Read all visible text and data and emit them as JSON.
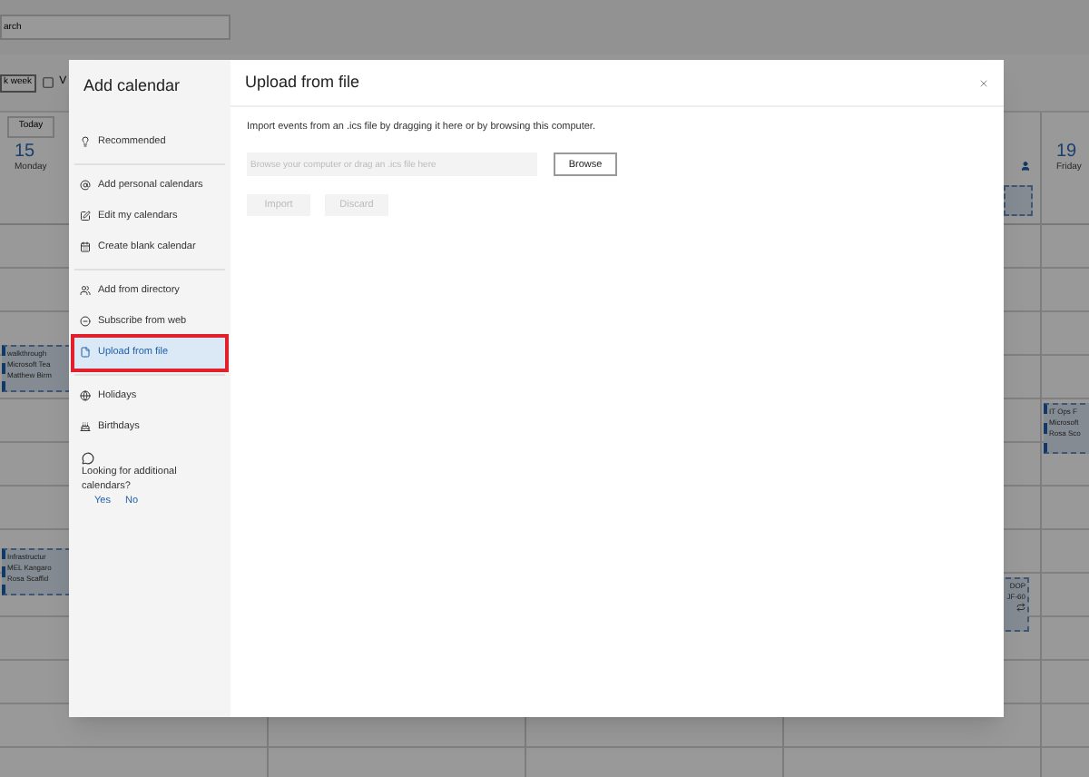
{
  "calendar": {
    "search": {
      "value": "arch"
    },
    "view_button": "k week",
    "view_toggle": {
      "label": "V",
      "checked": false
    },
    "today_button": "Today",
    "columns": [
      {
        "number": "15",
        "weekday": "Monday",
        "events": [
          {
            "lines": [
              "walkthrough",
              "Microsoft Tea",
              "Matthew Birm"
            ]
          },
          {
            "lines": [
              "Infrastructur",
              "MEL Kangaro",
              "Rosa Scaffid"
            ]
          }
        ]
      },
      {},
      {},
      {
        "events": [
          {
            "lines": [
              "DOP",
              "JF-60"
            ],
            "recurring": true
          }
        ]
      },
      {
        "number": "19",
        "weekday": "Friday",
        "events": [
          {
            "lines": [
              "IT Ops F",
              "Microsoft",
              "Rosa Sco"
            ]
          }
        ]
      }
    ]
  },
  "dialog": {
    "title": "Add calendar",
    "groups": [
      [
        {
          "label": "Recommended",
          "selected": false,
          "outlined": false
        }
      ],
      [
        {
          "label": "Add personal calendars",
          "selected": false,
          "outlined": false
        },
        {
          "label": "Edit my calendars",
          "selected": false,
          "outlined": false
        },
        {
          "label": "Create blank calendar",
          "selected": false,
          "outlined": false
        }
      ],
      [
        {
          "label": "Add from directory",
          "selected": false,
          "outlined": false
        },
        {
          "label": "Subscribe from web",
          "selected": false,
          "outlined": false
        },
        {
          "label": "Upload from file",
          "selected": true,
          "outlined": true
        }
      ],
      [
        {
          "label": "Holidays",
          "selected": false,
          "outlined": false
        },
        {
          "label": "Birthdays",
          "selected": false,
          "outlined": false
        }
      ]
    ],
    "feedback": {
      "question": "Looking for additional calendars?",
      "yes": "Yes",
      "no": "No"
    },
    "panel": {
      "title": "Upload from file",
      "description": "Import events from an .ics file by dragging it here or by browsing this computer.",
      "file_field": {
        "placeholder": "Browse your computer or drag an .ics file here"
      },
      "browse_button": {
        "label": "Browse",
        "disabled": false
      },
      "actions": [
        {
          "label": "Import",
          "disabled": true
        },
        {
          "label": "Discard",
          "disabled": true
        }
      ]
    }
  }
}
